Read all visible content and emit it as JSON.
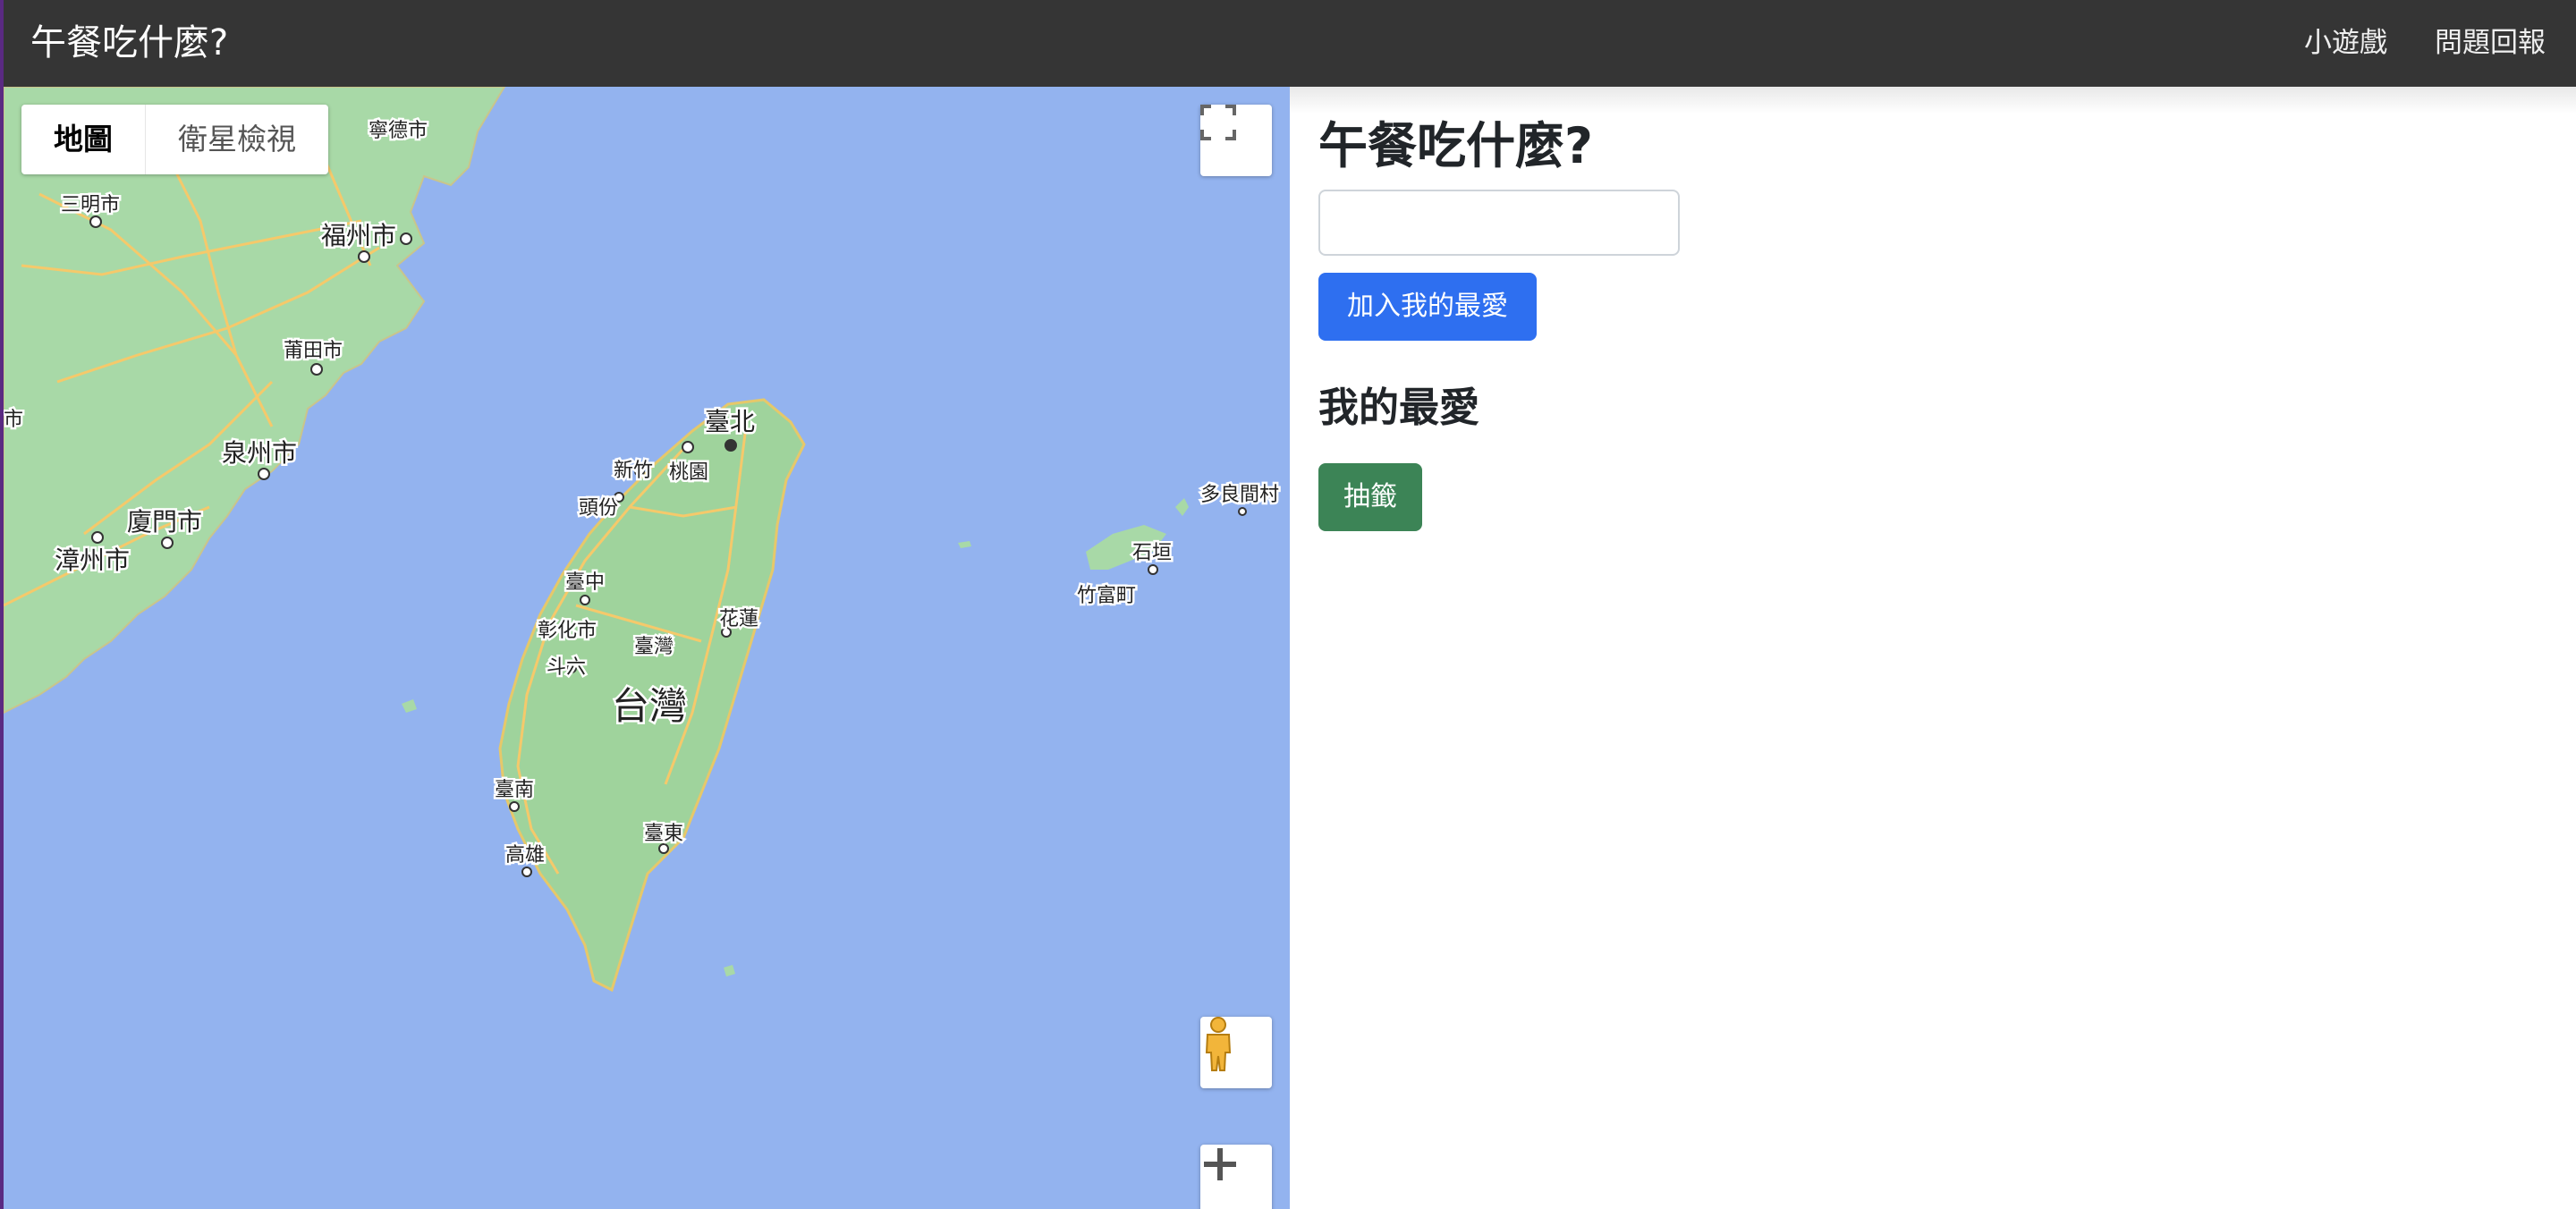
{
  "navbar": {
    "brand": "午餐吃什麼?",
    "links": [
      "小遊戲",
      "問題回報"
    ]
  },
  "map": {
    "map_types": [
      "地圖",
      "衛星檢視"
    ],
    "active_map_type": "地圖",
    "labels": {
      "ningde": "寧德市",
      "sanming": "三明市",
      "fuzhou": "福州市",
      "putian": "莆田市",
      "quanzhou": "泉州市",
      "xiamen": "廈門市",
      "zhangzhou": "漳州市",
      "partial_shi": "市",
      "taipei": "臺北",
      "hsinchu": "新竹",
      "taoyuan": "桃園",
      "toufen": "頭份",
      "taichung": "臺中",
      "changhua": "彰化市",
      "douliu": "斗六",
      "taiwan_small": "臺灣",
      "hualien": "花蓮",
      "taiwan": "台灣",
      "tainan": "臺南",
      "kaohsiung": "高雄",
      "taitung": "臺東",
      "taramamura": "多良間村",
      "ishigaki": "石垣",
      "taketomi": "竹富町"
    },
    "icons": {
      "fullscreen": "fullscreen-icon",
      "pegman": "pegman-icon",
      "zoom_in": "zoom-in-icon"
    }
  },
  "panel": {
    "title": "午餐吃什麼?",
    "input": {
      "value": "",
      "placeholder": ""
    },
    "add_button": "加入我的最愛",
    "favorites_heading": "我的最愛",
    "draw_button": "抽籤"
  },
  "colors": {
    "navbar": "#353535",
    "water": "#93b3ef",
    "land": "#a8d9a7",
    "primary_button": "#2e6ff0",
    "success_button": "#3c8456"
  }
}
